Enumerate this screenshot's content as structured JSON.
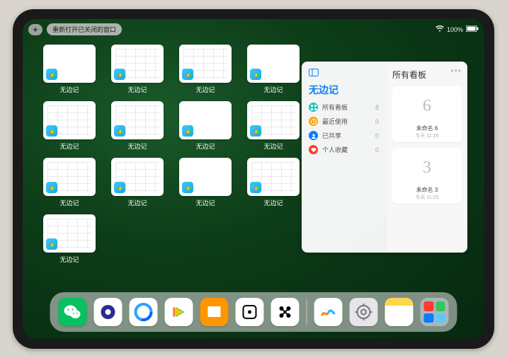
{
  "topbar": {
    "reopen_label": "重新打开已关闭的窗口",
    "battery_text": "100%"
  },
  "app_switcher": {
    "label": "无边记",
    "tiles": [
      {
        "style": "blank"
      },
      {
        "style": "grid"
      },
      {
        "style": "grid"
      },
      {
        "style": "blank"
      },
      {
        "style": "grid"
      },
      {
        "style": "grid"
      },
      {
        "style": "blank"
      },
      {
        "style": "grid"
      },
      {
        "style": "grid"
      },
      {
        "style": "grid"
      },
      {
        "style": "blank"
      },
      {
        "style": "grid"
      },
      {
        "style": "grid"
      }
    ]
  },
  "panel": {
    "title": "无边记",
    "right_title": "所有看板",
    "items": [
      {
        "icon": "grid",
        "color": "#16c9c0",
        "label": "所有看板",
        "count": 8
      },
      {
        "icon": "clock",
        "color": "#ff9f0a",
        "label": "最近使用",
        "count": 0
      },
      {
        "icon": "people",
        "color": "#0a7cff",
        "label": "已共享",
        "count": 0
      },
      {
        "icon": "heart",
        "color": "#ff3b30",
        "label": "个人收藏",
        "count": 0
      }
    ],
    "boards": [
      {
        "glyph": "6",
        "name": "未命名 6",
        "sub": "今天 11:26"
      },
      {
        "glyph": "3",
        "name": "未命名 3",
        "sub": "今天 11:25"
      }
    ]
  },
  "dock": {
    "apps": [
      {
        "name": "wechat",
        "bg": "#07c160"
      },
      {
        "name": "quark",
        "bg": "#ffffff"
      },
      {
        "name": "qq-browser",
        "bg": "#ffffff"
      },
      {
        "name": "video",
        "bg": "#ffffff"
      },
      {
        "name": "books",
        "bg": "#ff9500"
      },
      {
        "name": "dice",
        "bg": "#ffffff"
      },
      {
        "name": "connect",
        "bg": "#ffffff"
      }
    ],
    "recent": [
      {
        "name": "freeform",
        "bg": "#ffffff"
      },
      {
        "name": "settings",
        "bg": "#e5e5ea"
      },
      {
        "name": "notes",
        "bg": "#ffffff"
      }
    ]
  }
}
